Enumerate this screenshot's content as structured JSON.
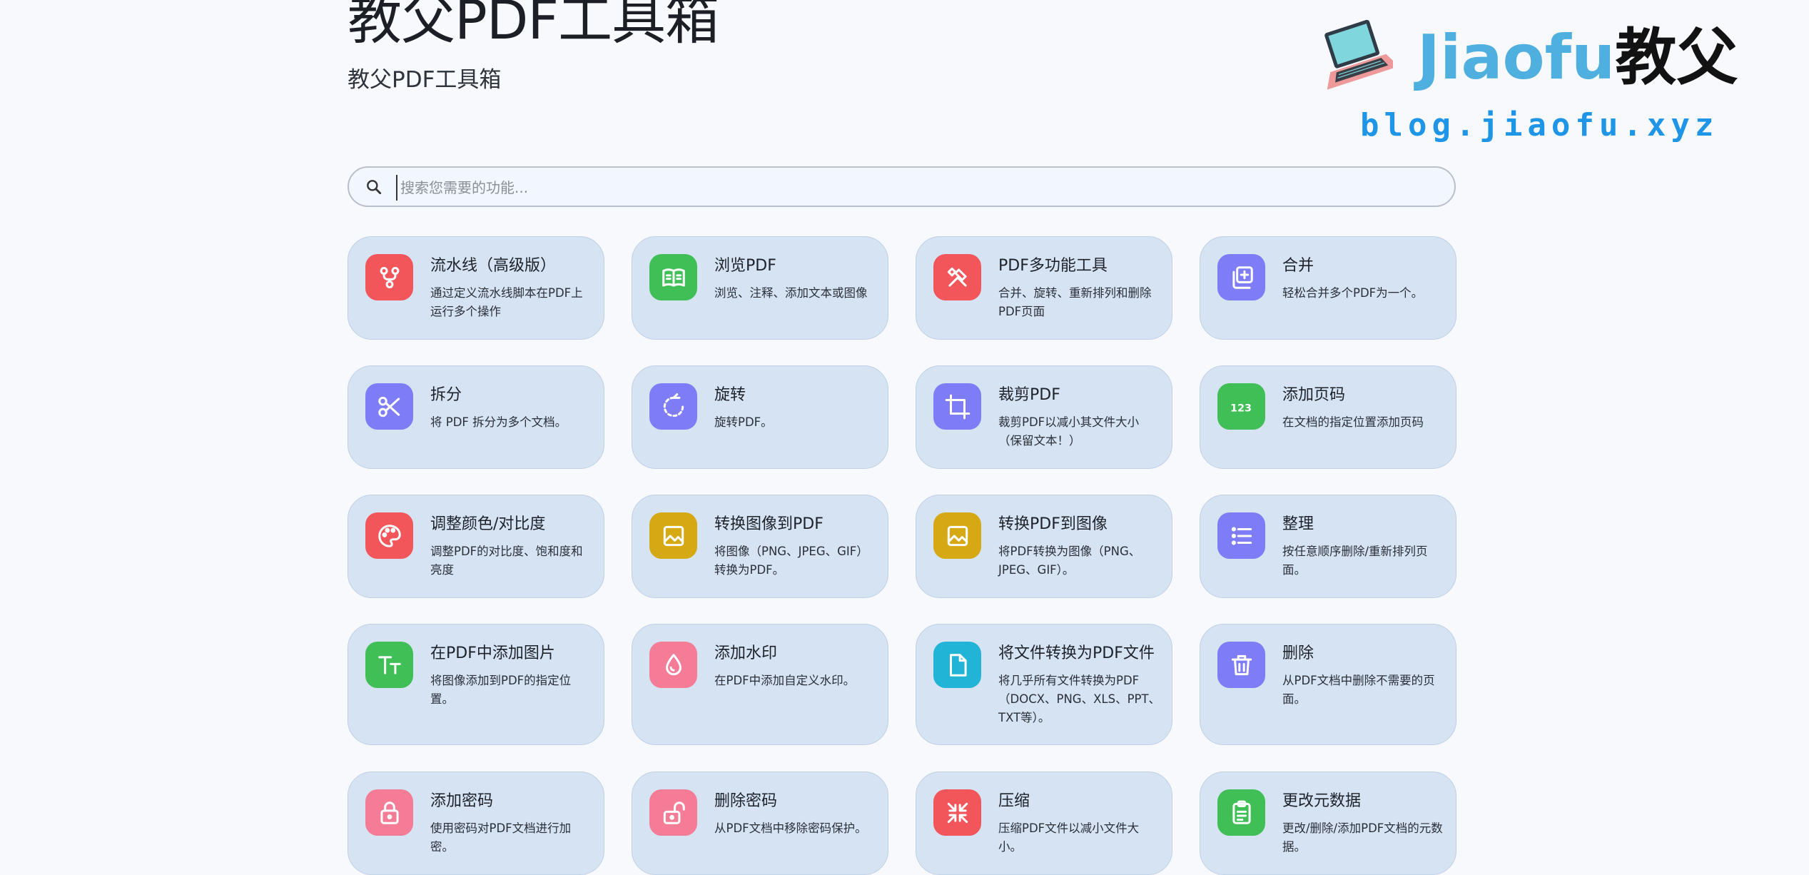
{
  "header": {
    "title": "教父PDF工具箱",
    "subtitle": "教父PDF工具箱"
  },
  "logo": {
    "brand_latin": "Jiaofu",
    "brand_cjk": "教父",
    "url": "blog.jiaofu.xyz",
    "icon": "laptop-icon"
  },
  "search": {
    "placeholder": "搜索您需要的功能...",
    "value": ""
  },
  "colors": {
    "red": "#f2555a",
    "green": "#3fbf56",
    "purple": "#7f7cf7",
    "yellow": "#d6a914",
    "cyan": "#21b4d6",
    "pink": "#f57c97",
    "card_bg": "#d6e3f3"
  },
  "tools": [
    {
      "title": "流水线（高级版）",
      "desc": "通过定义流水线脚本在PDF上运行多个操作",
      "icon": "pipeline-icon",
      "color": "#f2555a"
    },
    {
      "title": "浏览PDF",
      "desc": "浏览、注释、添加文本或图像",
      "icon": "book-icon",
      "color": "#3fbf56"
    },
    {
      "title": "PDF多功能工具",
      "desc": "合并、旋转、重新排列和删除PDF页面",
      "icon": "tools-icon",
      "color": "#f2555a"
    },
    {
      "title": "合并",
      "desc": "轻松合并多个PDF为一个。",
      "icon": "merge-icon",
      "color": "#7f7cf7"
    },
    {
      "title": "拆分",
      "desc": "将 PDF 拆分为多个文档。",
      "icon": "scissors-icon",
      "color": "#7f7cf7"
    },
    {
      "title": "旋转",
      "desc": "旋转PDF。",
      "icon": "rotate-icon",
      "color": "#7f7cf7"
    },
    {
      "title": "裁剪PDF",
      "desc": "裁剪PDF以减小其文件大小（保留文本！）",
      "icon": "crop-icon",
      "color": "#7f7cf7"
    },
    {
      "title": "添加页码",
      "desc": "在文档的指定位置添加页码",
      "icon": "numbers-icon",
      "color": "#3fbf56"
    },
    {
      "title": "调整颜色/对比度",
      "desc": "调整PDF的对比度、饱和度和亮度",
      "icon": "palette-icon",
      "color": "#f2555a"
    },
    {
      "title": "转换图像到PDF",
      "desc": "将图像（PNG、JPEG、GIF）转换为PDF。",
      "icon": "image-icon",
      "color": "#d6a914"
    },
    {
      "title": "转换PDF到图像",
      "desc": "将PDF转换为图像（PNG、JPEG、GIF）。",
      "icon": "image-icon",
      "color": "#d6a914"
    },
    {
      "title": "整理",
      "desc": "按任意顺序删除/重新排列页面。",
      "icon": "list-icon",
      "color": "#7f7cf7"
    },
    {
      "title": "在PDF中添加图片",
      "desc": "将图像添加到PDF的指定位置。",
      "icon": "text-size-icon",
      "color": "#3fbf56"
    },
    {
      "title": "添加水印",
      "desc": "在PDF中添加自定义水印。",
      "icon": "droplet-icon",
      "color": "#f57c97"
    },
    {
      "title": "将文件转换为PDF文件",
      "desc": "将几乎所有文件转换为PDF（DOCX、PNG、XLS、PPT、TXT等）。",
      "icon": "file-icon",
      "color": "#21b4d6"
    },
    {
      "title": "删除",
      "desc": "从PDF文档中删除不需要的页面。",
      "icon": "trash-icon",
      "color": "#7f7cf7"
    },
    {
      "title": "添加密码",
      "desc": "使用密码对PDF文档进行加密。",
      "icon": "lock-icon",
      "color": "#f57c97"
    },
    {
      "title": "删除密码",
      "desc": "从PDF文档中移除密码保护。",
      "icon": "unlock-icon",
      "color": "#f57c97"
    },
    {
      "title": "压缩",
      "desc": "压缩PDF文件以减小文件大小。",
      "icon": "compress-icon",
      "color": "#f2555a"
    },
    {
      "title": "更改元数据",
      "desc": "更改/删除/添加PDF文档的元数据。",
      "icon": "clipboard-icon",
      "color": "#3fbf56"
    }
  ]
}
